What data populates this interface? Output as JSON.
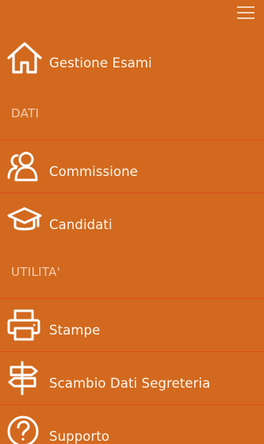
{
  "header": {
    "menu_icon": "hamburger-menu-icon"
  },
  "menu": {
    "home": {
      "label": "Gestione Esami",
      "icon": "home-icon"
    },
    "section_dati": "DATI",
    "commissione": {
      "label": "Commissione",
      "icon": "users-icon"
    },
    "candidati": {
      "label": "Candidati",
      "icon": "graduation-cap-icon"
    },
    "section_utilita": "UTILITA'",
    "stampe": {
      "label": "Stampe",
      "icon": "printer-icon"
    },
    "scambio": {
      "label": "Scambio Dati Segreteria",
      "icon": "signpost-icon"
    },
    "supporto": {
      "label": "Supporto",
      "icon": "question-circle-icon"
    }
  },
  "colors": {
    "background": "#d2691e",
    "divider": "#e04a1e",
    "section_text": "#f6cdb0",
    "text": "#ffffff"
  }
}
